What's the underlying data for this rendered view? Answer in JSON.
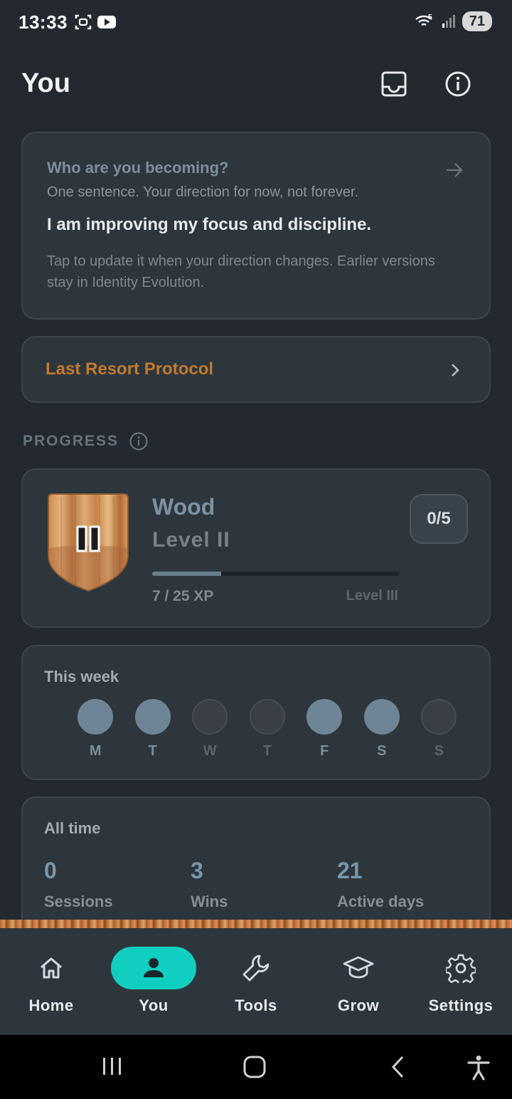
{
  "status_bar": {
    "time": "13:33",
    "battery": "71",
    "left_icons": [
      "screenshot-icon",
      "youtube-icon"
    ],
    "right_icons": [
      "wifi-icon",
      "signal-icon",
      "battery-icon"
    ]
  },
  "header": {
    "title": "You",
    "actions": [
      "inbox-icon",
      "info-icon"
    ]
  },
  "identity": {
    "question": "Who are you becoming?",
    "subtitle": "One sentence. Your direction for now, not forever.",
    "statement": "I am improving my focus and discipline.",
    "note": "Tap to update it when your direction changes. Earlier versions stay in Identity Evolution."
  },
  "last_resort": {
    "label": "Last Resort Protocol"
  },
  "progress_section": {
    "title": "PROGRESS"
  },
  "rank": {
    "badge_roman": "II",
    "name": "Wood",
    "level": "Level II",
    "count": "0/5",
    "xp_text": "7 / 25 XP",
    "xp_current": 7,
    "xp_target": 25,
    "next_level": "Level III"
  },
  "week": {
    "title": "This week",
    "days": [
      {
        "letter": "M",
        "active": true
      },
      {
        "letter": "T",
        "active": true
      },
      {
        "letter": "W",
        "active": false
      },
      {
        "letter": "T",
        "active": false
      },
      {
        "letter": "F",
        "active": true
      },
      {
        "letter": "S",
        "active": true
      },
      {
        "letter": "S",
        "active": false
      }
    ]
  },
  "all_time": {
    "title": "All time",
    "stats": [
      {
        "value": "0",
        "label": "Sessions"
      },
      {
        "value": "3",
        "label": "Wins"
      },
      {
        "value": "21",
        "label": "Active days"
      }
    ]
  },
  "nav": {
    "items": [
      {
        "label": "Home",
        "icon": "home-icon",
        "active": false
      },
      {
        "label": "You",
        "icon": "person-icon",
        "active": true
      },
      {
        "label": "Tools",
        "icon": "wrench-icon",
        "active": false
      },
      {
        "label": "Grow",
        "icon": "graduation-cap-icon",
        "active": false
      },
      {
        "label": "Settings",
        "icon": "gear-icon",
        "active": false
      }
    ]
  },
  "colors": {
    "background": "#23292f",
    "card": "#2e363d",
    "accent_teal": "#10cfc0",
    "resort_orange": "#c17a2e"
  }
}
